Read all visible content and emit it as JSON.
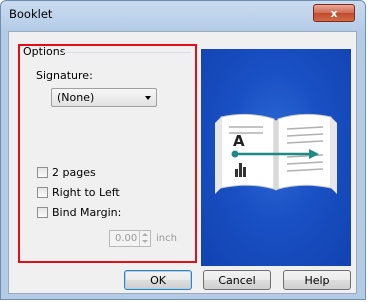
{
  "window": {
    "title": "Booklet",
    "close_label": "x"
  },
  "options": {
    "group_label": "Options",
    "signature_label": "Signature:",
    "signature_value": "(None)",
    "two_pages_label": "2 pages",
    "right_to_left_label": "Right to Left",
    "bind_margin_label": "Bind Margin:",
    "margin_value": "0.00",
    "margin_unit": "inch"
  },
  "buttons": {
    "ok": "OK",
    "cancel": "Cancel",
    "help": "Help"
  },
  "preview": {
    "page_letter": "A"
  }
}
